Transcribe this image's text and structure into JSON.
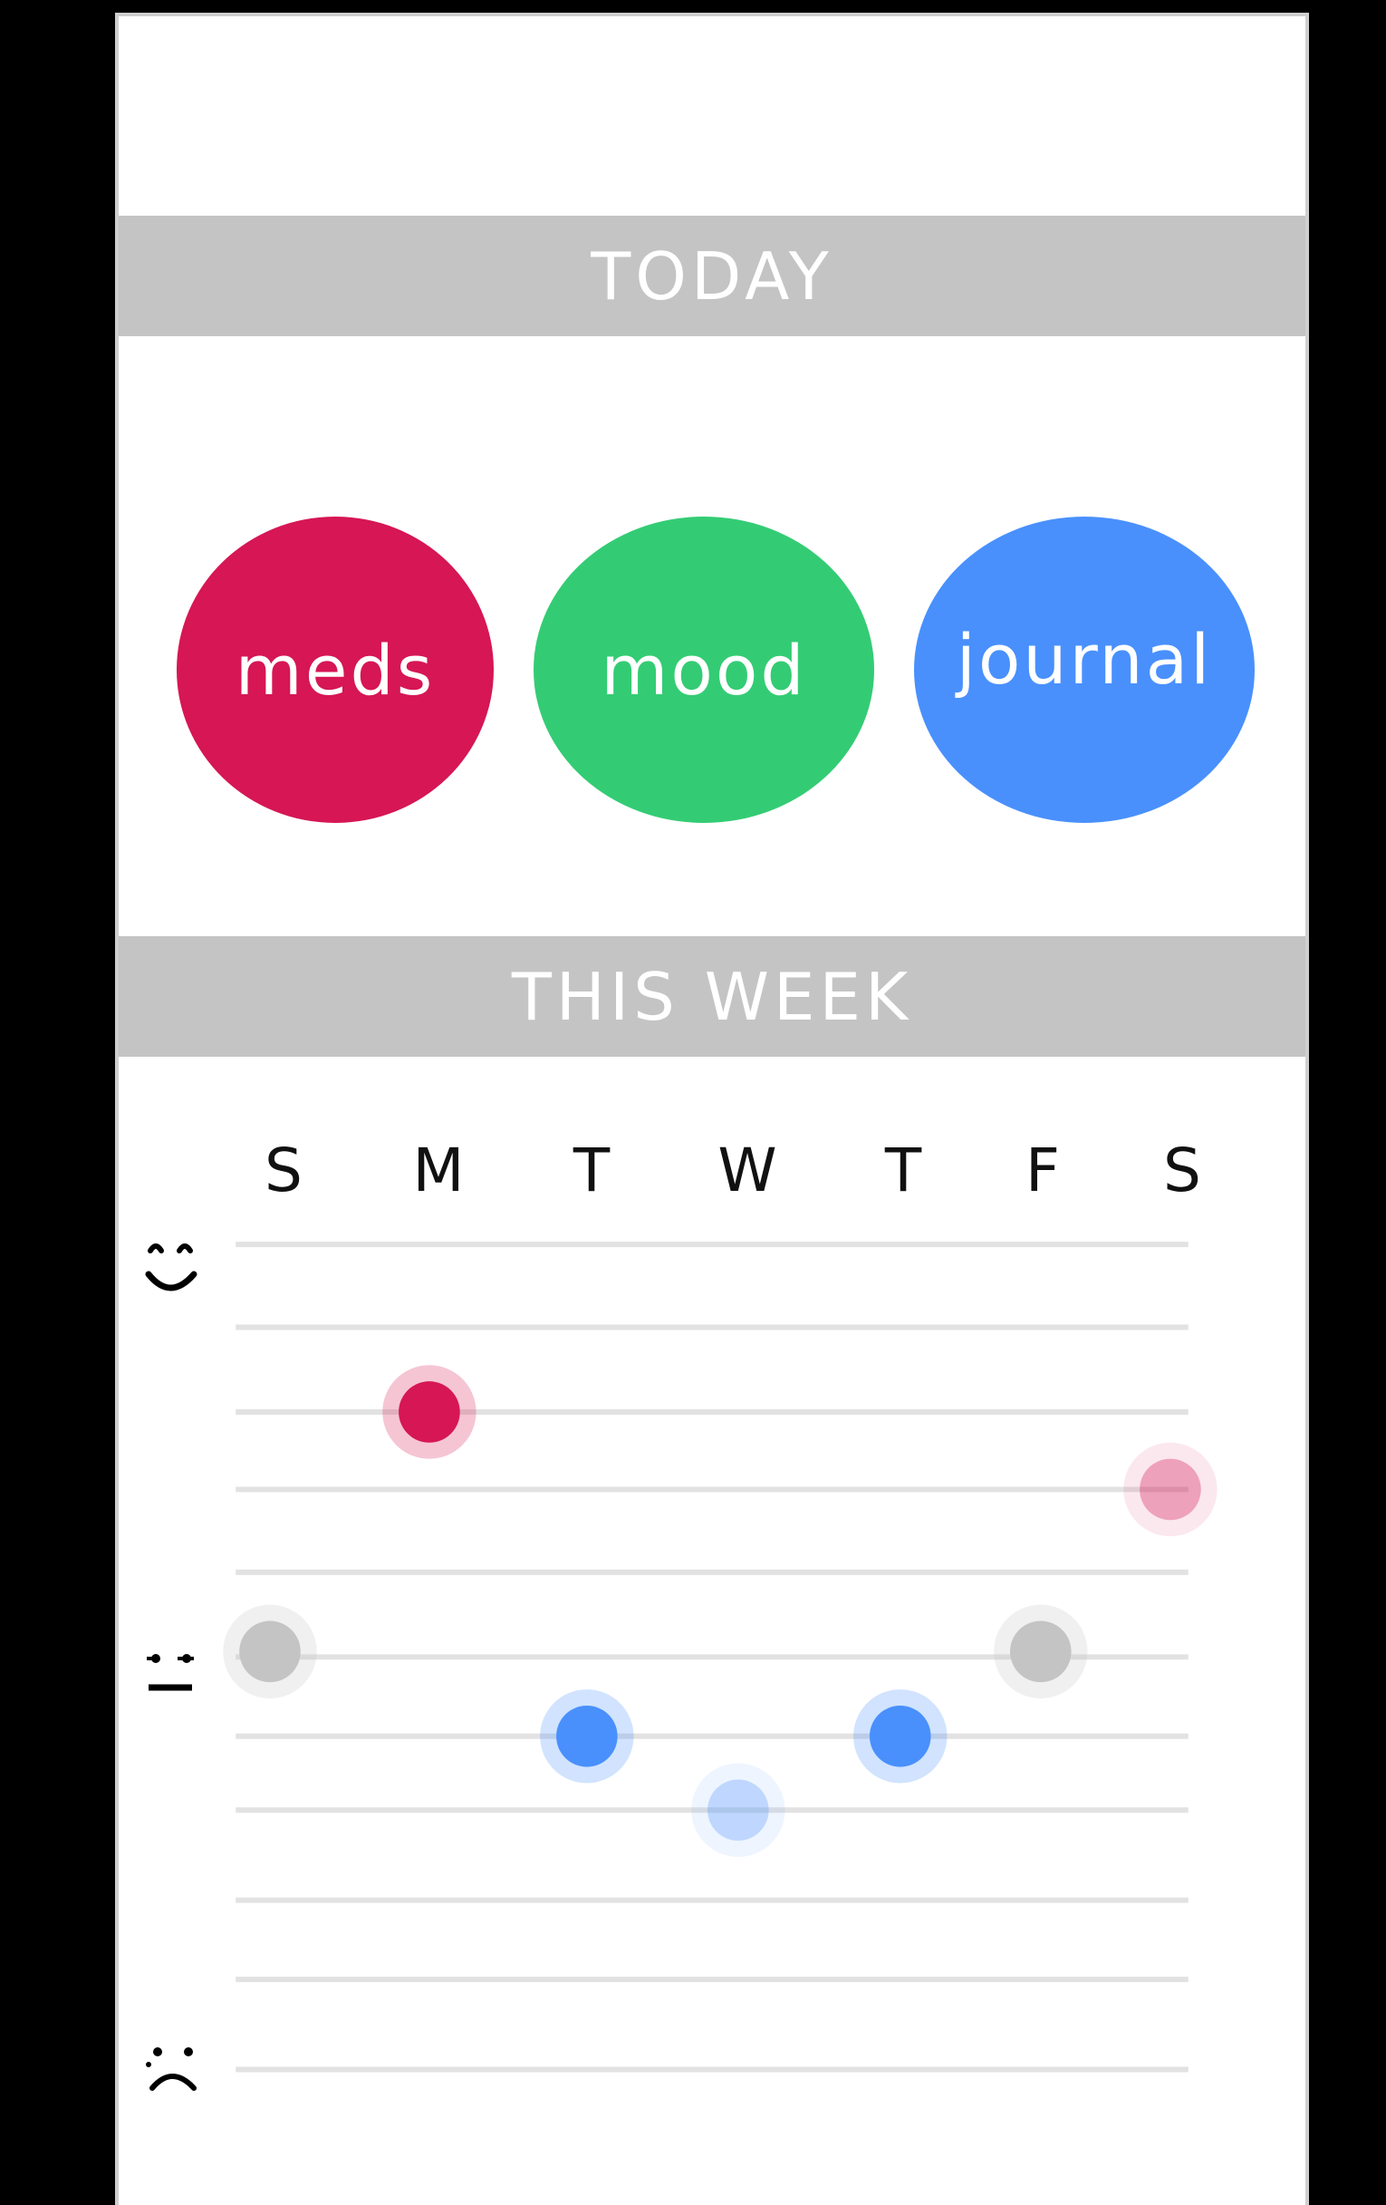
{
  "sections": {
    "today_label": "TODAY",
    "week_label": "THIS WEEK"
  },
  "actions": [
    {
      "label": "meds",
      "color": "#d61655"
    },
    {
      "label": "mood",
      "color": "#33cc74"
    },
    {
      "label": "journal",
      "color": "#4990fd"
    }
  ],
  "week": {
    "days": [
      "S",
      "M",
      "T",
      "W",
      "T",
      "F",
      "S"
    ],
    "mood_icons": [
      "happy-face-icon",
      "neutral-face-icon",
      "sad-face-icon"
    ]
  },
  "colors": {
    "section_bar": "#c4c4c4",
    "meds": "#d61655",
    "neutral": "#c4c4c4",
    "journal": "#4990fd"
  },
  "chart_data": {
    "type": "scatter",
    "x": [
      "S",
      "M",
      "T",
      "W",
      "T",
      "F",
      "S"
    ],
    "series": [
      {
        "color": "#d61655",
        "points": [
          {
            "x": "M",
            "level": 3,
            "opacity": 1
          },
          {
            "x": "S",
            "level": 4,
            "opacity": 0.4
          }
        ]
      },
      {
        "color": "#c4c4c4",
        "points": [
          {
            "x": "S",
            "level": 6,
            "opacity": 1
          },
          {
            "x": "F",
            "level": 6,
            "opacity": 1
          }
        ]
      },
      {
        "color": "#4990fd",
        "points": [
          {
            "x": "T",
            "level": 7,
            "opacity": 1
          },
          {
            "x": "W",
            "level": 8,
            "opacity": 0.35
          },
          {
            "x": "T",
            "level": 7,
            "opacity": 1
          }
        ]
      }
    ],
    "levels": 11,
    "grid": true
  }
}
